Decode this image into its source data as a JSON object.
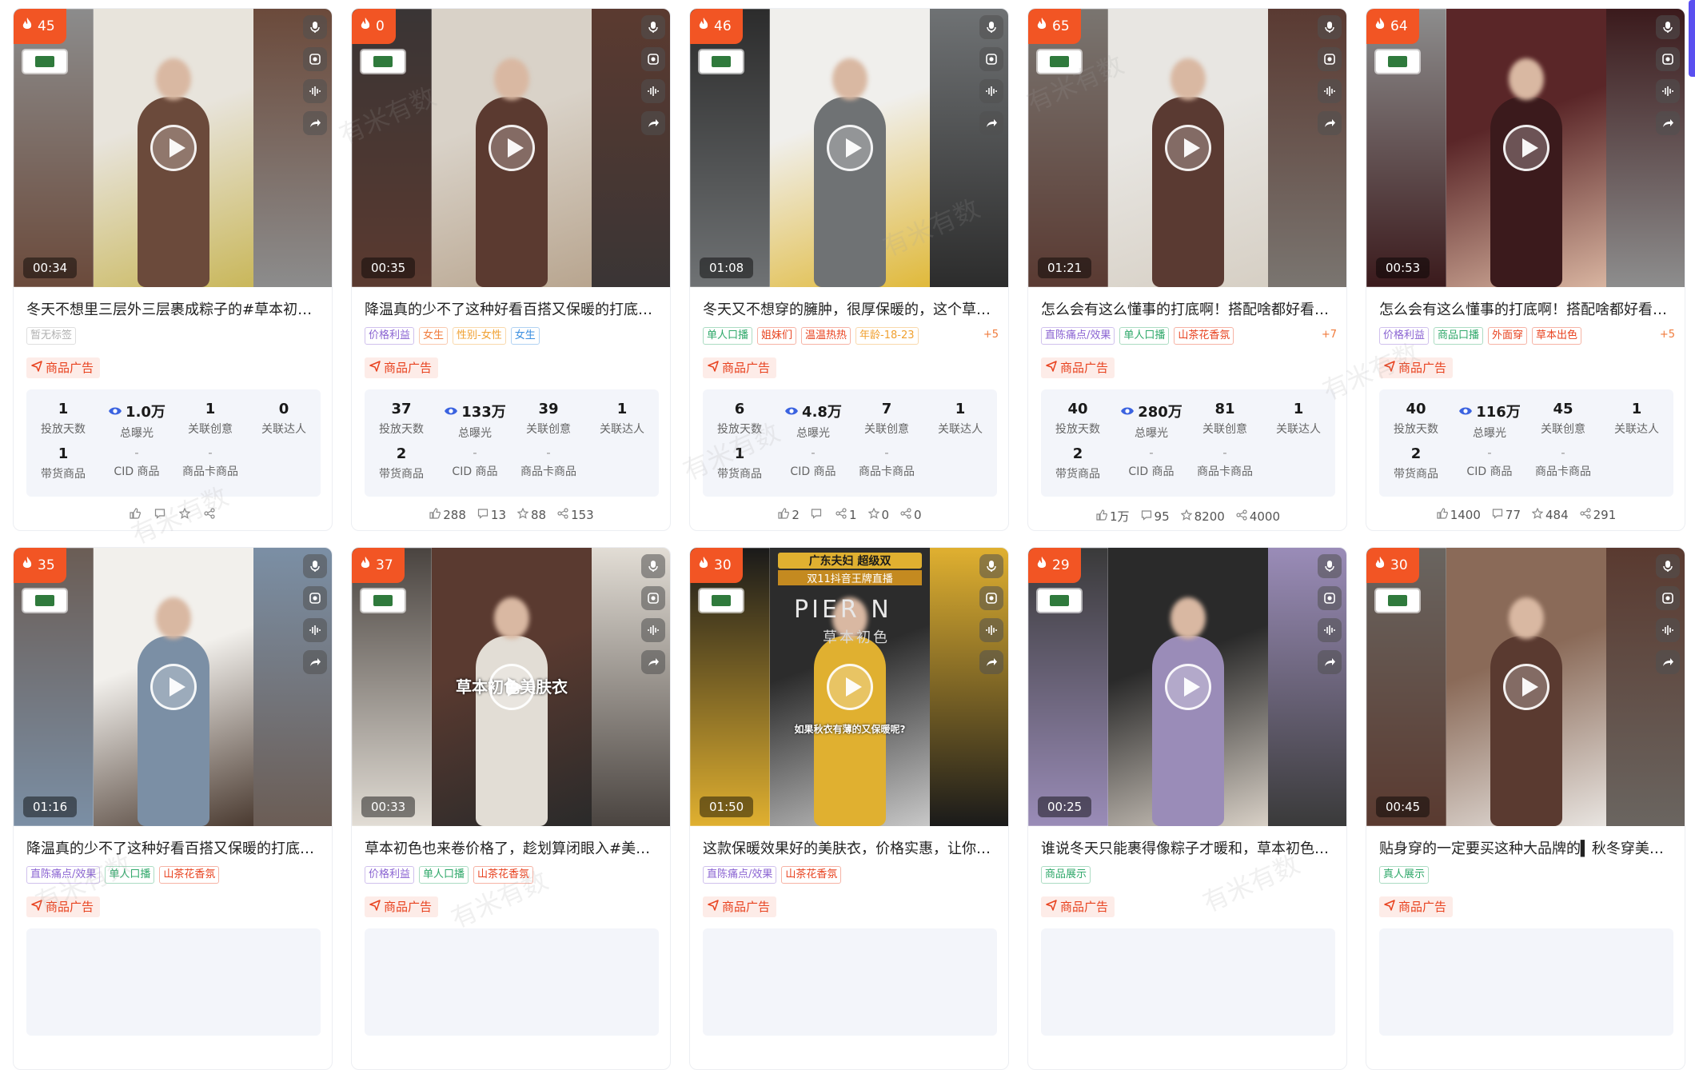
{
  "watermark_text": "有米有数",
  "colors": {
    "heat_badge": "#f25524",
    "ad_label": "#e8421f",
    "accent_purple": "#5a4ff0"
  },
  "cards": [
    {
      "heat": "45",
      "duration": "00:34",
      "title": "冬天不想里三层外三层裹成粽子的#草本初色 ...",
      "tags": [
        {
          "text": "暂无标签",
          "color": "#b0b0b0"
        }
      ],
      "tags_more": "",
      "ad_label": "商品广告",
      "stats": {
        "days": "1",
        "exposure": "1.0万",
        "creatives": "1",
        "influencers": "0",
        "products": "1",
        "cid_products": "-",
        "card_products": "-"
      },
      "engagement": {
        "likes": "",
        "comments": "",
        "favorites": "",
        "shares": ""
      },
      "palette": [
        "#8c8c8c",
        "#e8e4dc",
        "#6b4a3b",
        "#c9b75a"
      ]
    },
    {
      "heat": "0",
      "duration": "00:35",
      "title": "降温真的少不了这种好看百搭又保暖的打底衫...",
      "tags": [
        {
          "text": "价格利益",
          "color": "#8a63d2"
        },
        {
          "text": "女生",
          "color": "#f07a3a"
        },
        {
          "text": "性别-女性",
          "color": "#f0a030"
        },
        {
          "text": "女生",
          "color": "#3b8fe0"
        }
      ],
      "tags_more": "",
      "ad_label": "商品广告",
      "stats": {
        "days": "37",
        "exposure": "133万",
        "creatives": "39",
        "influencers": "1",
        "products": "2",
        "cid_products": "-",
        "card_products": "-"
      },
      "engagement": {
        "likes": "288",
        "comments": "13",
        "favorites": "88",
        "shares": "153"
      },
      "palette": [
        "#3a3535",
        "#d9d2c8",
        "#5b3a30",
        "#b8a58f"
      ]
    },
    {
      "heat": "46",
      "duration": "01:08",
      "title": "冬天又不想穿的臃肿，很厚保暖的，这个草本...",
      "tags": [
        {
          "text": "单人口播",
          "color": "#2fa86a"
        },
        {
          "text": "姐妹们",
          "color": "#e8421f"
        },
        {
          "text": "温温热热",
          "color": "#e8421f"
        },
        {
          "text": "年龄-18-23",
          "color": "#f0a030"
        }
      ],
      "tags_more": "+5",
      "ad_label": "商品广告",
      "stats": {
        "days": "6",
        "exposure": "4.8万",
        "creatives": "7",
        "influencers": "1",
        "products": "1",
        "cid_products": "-",
        "card_products": "-"
      },
      "engagement": {
        "likes": "2",
        "comments": "",
        "favorites": "0",
        "shares": "0",
        "shares2": "1"
      },
      "palette": [
        "#2c2c2c",
        "#f0efec",
        "#6f7274",
        "#e0b93a"
      ]
    },
    {
      "heat": "65",
      "duration": "01:21",
      "title": "怎么会有这么懂事的打底啊！搭配啥都好看，...",
      "tags": [
        {
          "text": "直陈痛点/效果",
          "color": "#8a63d2"
        },
        {
          "text": "单人口播",
          "color": "#2fa86a"
        },
        {
          "text": "山茶花香氛",
          "color": "#e8421f"
        }
      ],
      "tags_more": "+7",
      "ad_label": "商品广告",
      "stats": {
        "days": "40",
        "exposure": "280万",
        "creatives": "81",
        "influencers": "1",
        "products": "2",
        "cid_products": "-",
        "card_products": "-"
      },
      "engagement": {
        "likes": "1万",
        "comments": "95",
        "favorites": "8200",
        "shares": "4000"
      },
      "palette": [
        "#7a7570",
        "#e8e6e2",
        "#5a3a32",
        "#d6cfc4"
      ]
    },
    {
      "heat": "64",
      "duration": "00:53",
      "title": "怎么会有这么懂事的打底啊！搭配啥都好看，...",
      "tags": [
        {
          "text": "价格利益",
          "color": "#8a63d2"
        },
        {
          "text": "商品口播",
          "color": "#2fa86a"
        },
        {
          "text": "外面穿",
          "color": "#e8421f"
        },
        {
          "text": "草本出色",
          "color": "#e8421f"
        }
      ],
      "tags_more": "+5",
      "ad_label": "商品广告",
      "stats": {
        "days": "40",
        "exposure": "116万",
        "creatives": "45",
        "influencers": "1",
        "products": "2",
        "cid_products": "-",
        "card_products": "-"
      },
      "engagement": {
        "likes": "1400",
        "comments": "77",
        "favorites": "484",
        "shares": "291"
      },
      "palette": [
        "#8d8d8d",
        "#5a2628",
        "#3b1a1c",
        "#d8b4a0"
      ]
    },
    {
      "heat": "35",
      "duration": "01:16",
      "title": "降温真的少不了这种好看百搭又保暖的打底衫...",
      "tags": [
        {
          "text": "直陈痛点/效果",
          "color": "#8a63d2"
        },
        {
          "text": "单人口播",
          "color": "#2fa86a"
        },
        {
          "text": "山茶花香氛",
          "color": "#e8421f"
        }
      ],
      "tags_more": "",
      "ad_label": "商品广告",
      "stats": null,
      "engagement": null,
      "palette": [
        "#6b5d55",
        "#f2f0ec",
        "#7b8fa5",
        "#4a3a30"
      ]
    },
    {
      "heat": "37",
      "duration": "00:33",
      "title": "草本初色也来卷价格了，趁划算闭眼入#美肤...",
      "tags": [
        {
          "text": "价格利益",
          "color": "#8a63d2"
        },
        {
          "text": "单人口播",
          "color": "#2fa86a"
        },
        {
          "text": "山茶花香氛",
          "color": "#e8421f"
        }
      ],
      "tags_more": "",
      "ad_label": "商品广告",
      "overlay_text": "草本初色美肤衣",
      "stats": null,
      "engagement": null,
      "palette": [
        "#4a4440",
        "#5a3a30",
        "#e2ddd5",
        "#2a2a2a"
      ]
    },
    {
      "heat": "30",
      "duration": "01:50",
      "title": "这款保暖效果好的美肤衣，价格实惠，让你秋...",
      "tags": [
        {
          "text": "直陈痛点/效果",
          "color": "#8a63d2"
        },
        {
          "text": "山茶花香氛",
          "color": "#e8421f"
        }
      ],
      "tags_more": "",
      "ad_label": "商品广告",
      "overlay_text": "如果秋衣有薄的又保暖呢?",
      "banner_text": "广东夫妇 超级双",
      "banner_text2": "双11抖音王牌直播",
      "stage_text": "PIER N",
      "stage_text2": "草本初色",
      "stats": null,
      "engagement": null,
      "palette": [
        "#1a1a1a",
        "#2c2c2c",
        "#e0b030",
        "#c8c8c8"
      ]
    },
    {
      "heat": "29",
      "duration": "00:25",
      "title": "谁说冬天只能裹得像粽子才暖和，草本初色山...",
      "tags": [
        {
          "text": "商品展示",
          "color": "#2fa86a"
        }
      ],
      "tags_more": "",
      "ad_label": "商品广告",
      "stats": null,
      "engagement": null,
      "palette": [
        "#3a3a3a",
        "#2a2a2a",
        "#9a8cb8",
        "#d8d0c6"
      ]
    },
    {
      "heat": "30",
      "duration": "00:45",
      "title": "贴身穿的一定要买这种大品牌的▍秋冬穿美肤...",
      "tags": [
        {
          "text": "真人展示",
          "color": "#2fa86a"
        }
      ],
      "tags_more": "",
      "ad_label": "商品广告",
      "stats": null,
      "engagement": null,
      "palette": [
        "#6a6560",
        "#8a6a58",
        "#5a3a30",
        "#e8e4e0"
      ]
    }
  ],
  "stat_labels": {
    "days": "投放天数",
    "exposure": "总曝光",
    "creatives": "关联创意",
    "influencers": "关联达人",
    "products": "带货商品",
    "cid_products": "CID 商品",
    "card_products": "商品卡商品"
  }
}
